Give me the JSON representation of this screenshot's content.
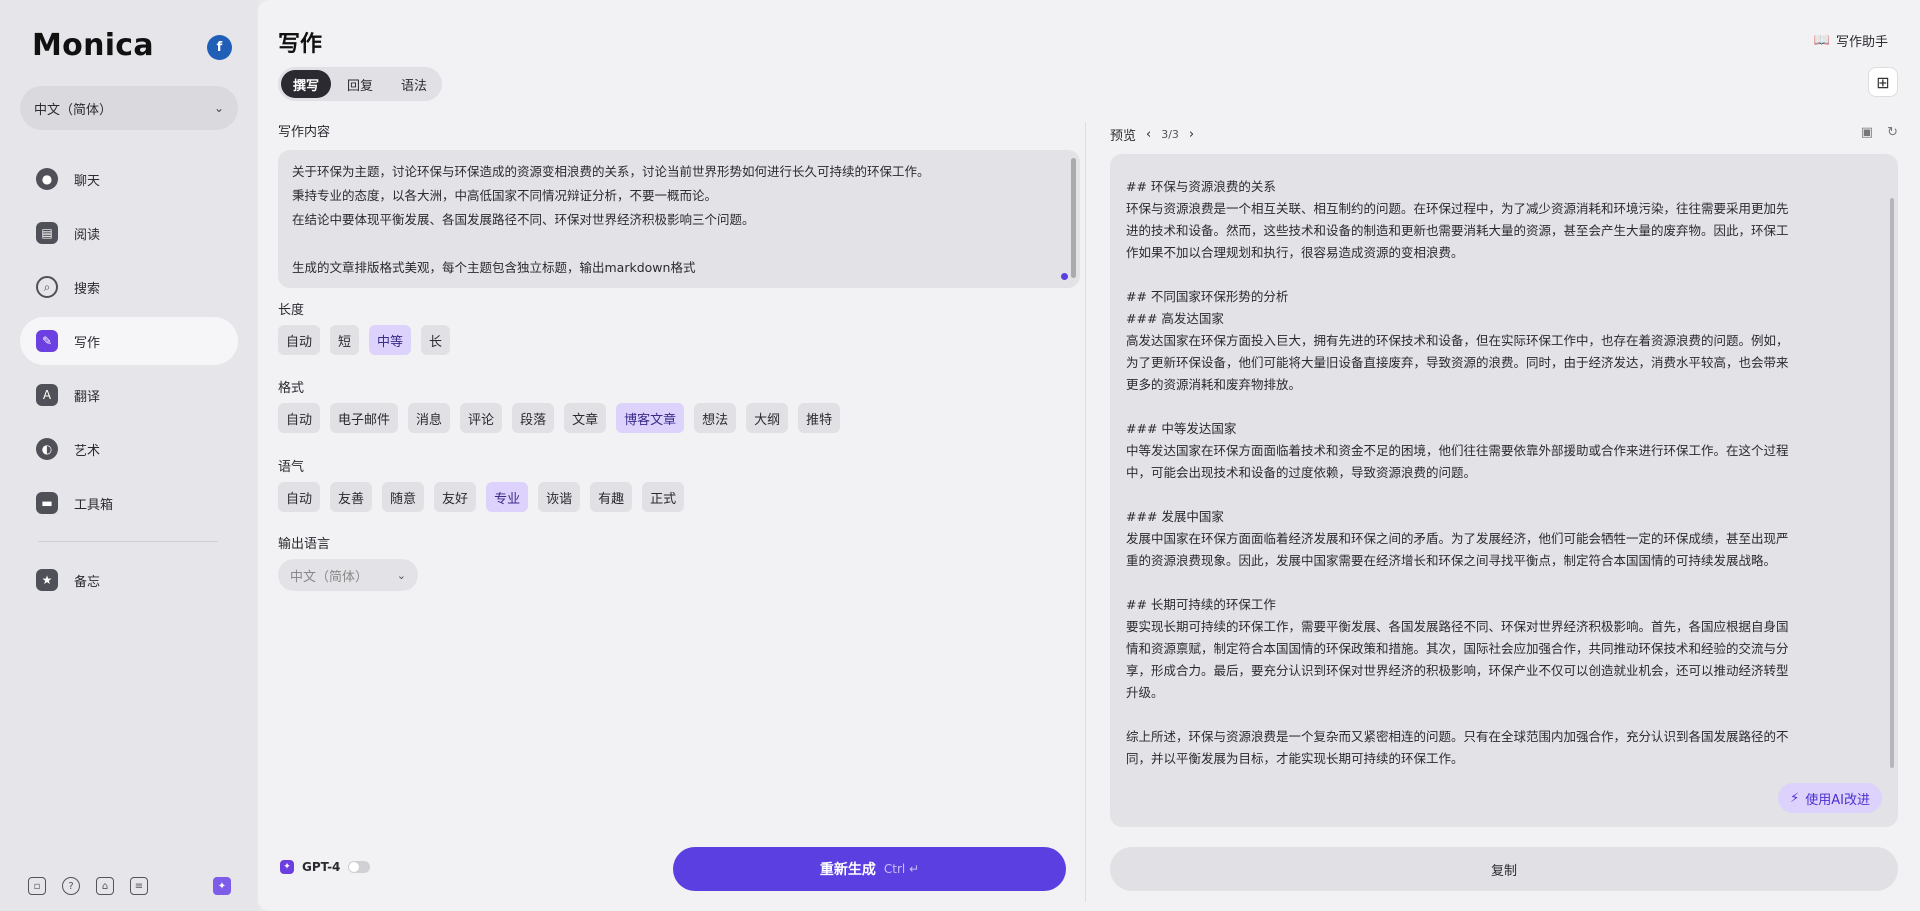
{
  "sidebar": {
    "brand": "Monica",
    "badge": "f",
    "language": "中文（简体）",
    "items": [
      {
        "label": "聊天",
        "icon": "chat-icon"
      },
      {
        "label": "阅读",
        "icon": "read-icon"
      },
      {
        "label": "搜索",
        "icon": "search-icon"
      },
      {
        "label": "写作",
        "icon": "write-icon"
      },
      {
        "label": "翻译",
        "icon": "translate-icon"
      },
      {
        "label": "艺术",
        "icon": "art-icon"
      },
      {
        "label": "工具箱",
        "icon": "toolbox-icon"
      },
      {
        "label": "备忘",
        "icon": "memo-icon"
      }
    ],
    "active_item": "写作"
  },
  "header": {
    "title": "写作",
    "helper": "写作助手",
    "tabs": [
      "撰写",
      "回复",
      "语法"
    ],
    "active_tab": "撰写"
  },
  "form": {
    "content_label": "写作内容",
    "content_lines": [
      "关于环保为主题，讨论环保与环保造成的资源变相浪费的关系，讨论当前世界形势如何进行长久可持续的环保工作。",
      "秉持专业的态度，以各大洲，中高低国家不同情况辩证分析，不要一概而论。",
      "在结论中要体现平衡发展、各国发展路径不同、环保对世界经济积极影响三个问题。",
      "",
      "生成的文章排版格式美观，每个主题包含独立标题，输出markdown格式"
    ],
    "length_label": "长度",
    "length_options": [
      "自动",
      "短",
      "中等",
      "长"
    ],
    "length_selected": "中等",
    "format_label": "格式",
    "format_options": [
      "自动",
      "电子邮件",
      "消息",
      "评论",
      "段落",
      "文章",
      "博客文章",
      "想法",
      "大纲",
      "推特"
    ],
    "format_selected": "博客文章",
    "tone_label": "语气",
    "tone_options": [
      "自动",
      "友善",
      "随意",
      "友好",
      "专业",
      "诙谐",
      "有趣",
      "正式"
    ],
    "tone_selected": "专业",
    "output_lang_label": "输出语言",
    "output_lang": "中文（简体）",
    "model": "GPT-4",
    "regenerate": "重新生成",
    "shortcut": "Ctrl ↵"
  },
  "preview": {
    "label": "预览",
    "pager": "3/3",
    "lines": [
      "## 环保与资源浪费的关系",
      "环保与资源浪费是一个相互关联、相互制约的问题。在环保过程中，为了减少资源消耗和环境污染，往往需要采用更加先",
      "进的技术和设备。然而，这些技术和设备的制造和更新也需要消耗大量的资源，甚至会产生大量的废弃物。因此，环保工",
      "作如果不加以合理规划和执行，很容易造成资源的变相浪费。",
      "",
      "## 不同国家环保形势的分析",
      "### 高发达国家",
      "高发达国家在环保方面投入巨大，拥有先进的环保技术和设备，但在实际环保工作中，也存在着资源浪费的问题。例如，",
      "为了更新环保设备，他们可能将大量旧设备直接废弃，导致资源的浪费。同时，由于经济发达，消费水平较高，也会带来",
      "更多的资源消耗和废弃物排放。",
      "",
      "### 中等发达国家",
      "中等发达国家在环保方面面临着技术和资金不足的困境，他们往往需要依靠外部援助或合作来进行环保工作。在这个过程",
      "中，可能会出现技术和设备的过度依赖，导致资源浪费的问题。",
      "",
      "### 发展中国家",
      "发展中国家在环保方面面临着经济发展和环保之间的矛盾。为了发展经济，他们可能会牺牲一定的环保成绩，甚至出现严",
      "重的资源浪费现象。因此，发展中国家需要在经济增长和环保之间寻找平衡点，制定符合本国国情的可持续发展战略。",
      "",
      "## 长期可持续的环保工作",
      "要实现长期可持续的环保工作，需要平衡发展、各国发展路径不同、环保对世界经济积极影响。首先，各国应根据自身国",
      "情和资源禀赋，制定符合本国国情的环保政策和措施。其次，国际社会应加强合作，共同推动环保技术和经验的交流与分",
      "享，形成合力。最后，要充分认识到环保对世界经济的积极影响，环保产业不仅可以创造就业机会，还可以推动经济转型",
      "升级。",
      "",
      "综上所述，环保与资源浪费是一个复杂而又紧密相连的问题。只有在全球范围内加强合作，充分认识到各国发展路径的不",
      "同，并以平衡发展为目标，才能实现长期可持续的环保工作。"
    ],
    "ai_improve": "使用AI改进",
    "copy": "复制"
  }
}
